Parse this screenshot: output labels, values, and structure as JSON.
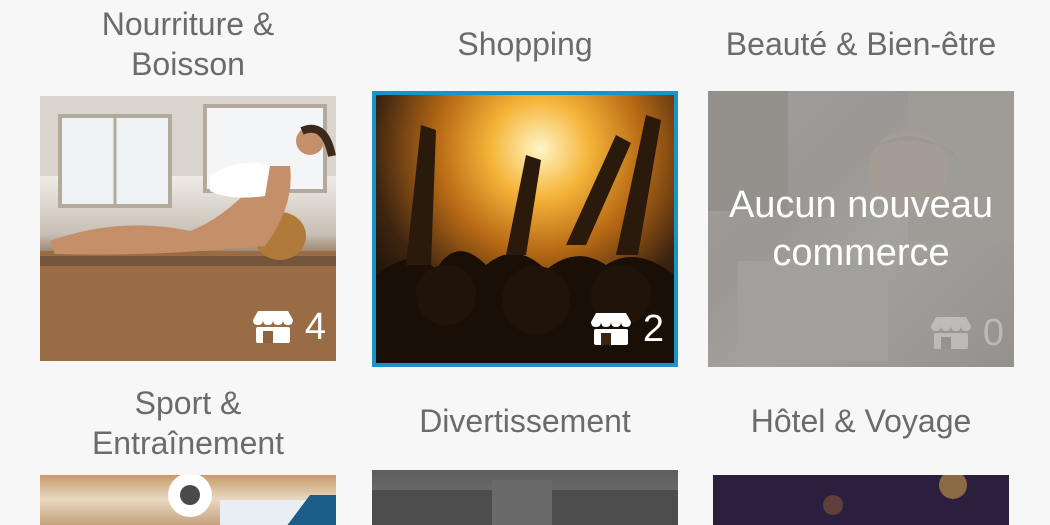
{
  "categories": [
    {
      "title_line1": "Nourriture &",
      "title_line2": "Boisson",
      "count": "4",
      "icon": "store-icon"
    },
    {
      "title_line1": "Shopping",
      "count": "2",
      "icon": "store-icon"
    },
    {
      "title_line1": "Beauté & Bien-être",
      "count": "0",
      "icon": "store-icon",
      "empty_line1": "Aucun nouveau",
      "empty_line2": "commerce"
    },
    {
      "title_line1": "Sport &",
      "title_line2": "Entraînement"
    },
    {
      "title_line1": "Divertissement"
    },
    {
      "title_line1": "Hôtel & Voyage"
    }
  ],
  "colors": {
    "selected_border": "#1b93c8",
    "title_text": "#6b6b6b",
    "background": "#f7f7f7"
  }
}
